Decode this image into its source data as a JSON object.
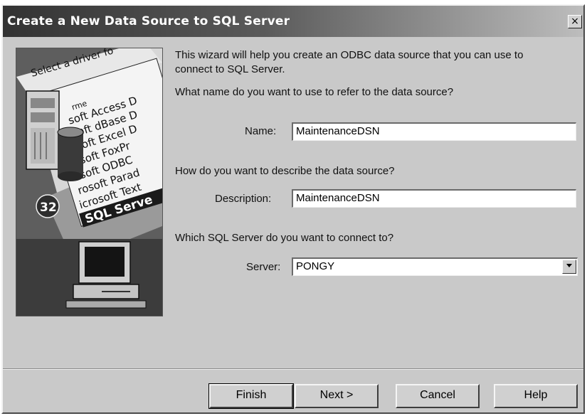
{
  "window": {
    "title": "Create a New Data Source to SQL Server",
    "close_glyph": "×"
  },
  "wizard_art": {
    "caption": "Select a driver fo",
    "drivers": [
      "rme",
      "soft Access D",
      "soft dBase D",
      "soft Excel D",
      "rosoft FoxPr",
      "osoft ODBC",
      "rosoft Parad",
      "icrosoft Text",
      "SQL Serve"
    ],
    "badge": "32",
    "icons": [
      "server-tower-icon",
      "database-cylinder-icon",
      "computer-monitor-icon"
    ]
  },
  "intro": {
    "line1": "This wizard will help you create an ODBC data source that you can use to",
    "line2": "connect to SQL Server."
  },
  "name_section": {
    "question": "What name do you want to use to refer to the data source?",
    "label": "Name:",
    "value": "MaintenanceDSN"
  },
  "description_section": {
    "question": "How do you want to describe the data source?",
    "label": "Description:",
    "value": "MaintenanceDSN"
  },
  "server_section": {
    "question": "Which SQL Server do you want to connect to?",
    "label": "Server:",
    "value": "PONGY",
    "dropdown_icon": "chevron-down-icon"
  },
  "buttons": {
    "finish": "Finish",
    "next": "Next >",
    "cancel": "Cancel",
    "help": "Help"
  }
}
